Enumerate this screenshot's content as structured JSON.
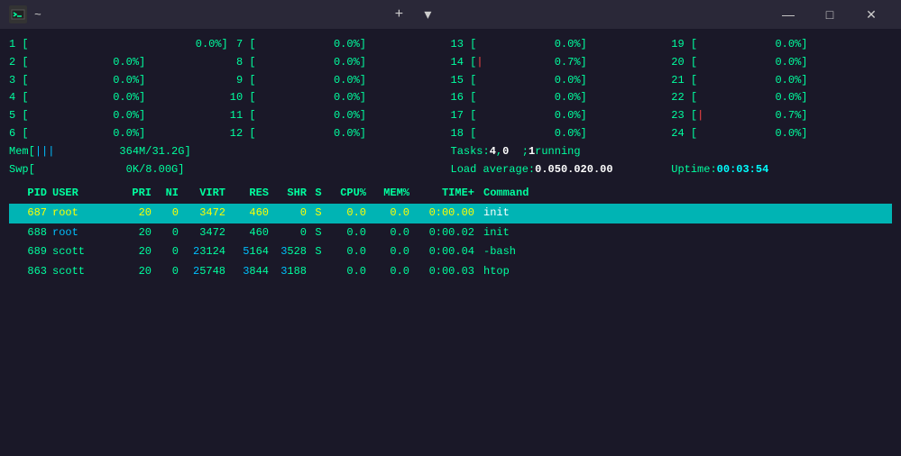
{
  "window": {
    "title": "~",
    "icon": "terminal-icon"
  },
  "titlebar": {
    "title": "~",
    "min_label": "—",
    "max_label": "□",
    "close_label": "✕",
    "new_tab_label": "+",
    "dropdown_label": "▾"
  },
  "cpu_rows": [
    {
      "num": "1",
      "bar": "",
      "pct": "0.0%"
    },
    {
      "num": "7",
      "bar": "",
      "pct": "0.0%"
    },
    {
      "num": "13",
      "bar": "",
      "pct": "0.0%"
    },
    {
      "num": "19",
      "bar": "",
      "pct": "0.0%"
    },
    {
      "num": "2",
      "bar": "",
      "pct": "0.0%"
    },
    {
      "num": "8",
      "bar": "",
      "pct": "0.0%"
    },
    {
      "num": "14",
      "bar": "|",
      "pct": "0.7%"
    },
    {
      "num": "20",
      "bar": "",
      "pct": "0.0%"
    },
    {
      "num": "3",
      "bar": "",
      "pct": "0.0%"
    },
    {
      "num": "9",
      "bar": "",
      "pct": "0.0%"
    },
    {
      "num": "15",
      "bar": "",
      "pct": "0.0%"
    },
    {
      "num": "21",
      "bar": "",
      "pct": "0.0%"
    },
    {
      "num": "4",
      "bar": "",
      "pct": "0.0%"
    },
    {
      "num": "10",
      "bar": "",
      "pct": "0.0%"
    },
    {
      "num": "16",
      "bar": "",
      "pct": "0.0%"
    },
    {
      "num": "22",
      "bar": "",
      "pct": "0.0%"
    },
    {
      "num": "5",
      "bar": "",
      "pct": "0.0%"
    },
    {
      "num": "11",
      "bar": "",
      "pct": "0.0%"
    },
    {
      "num": "17",
      "bar": "",
      "pct": "0.0%"
    },
    {
      "num": "23",
      "bar": "|",
      "pct": "0.7%"
    },
    {
      "num": "6",
      "bar": "",
      "pct": "0.0%"
    },
    {
      "num": "12",
      "bar": "",
      "pct": "0.0%"
    },
    {
      "num": "18",
      "bar": "",
      "pct": "0.0%"
    },
    {
      "num": "24",
      "bar": "",
      "pct": "0.0%"
    }
  ],
  "mem": {
    "label": "Mem",
    "bars": "|||",
    "value": "364M/31.2G]"
  },
  "swp": {
    "label": "Swp",
    "bars": "",
    "value": "0K/8.00G]"
  },
  "tasks": {
    "label": "Tasks:",
    "total": "4",
    "sleeping": "0",
    "running_label": "running",
    "running_count": "1"
  },
  "load": {
    "label": "Load average:",
    "v1": "0.05",
    "v2": "0.02",
    "v3": "0.00"
  },
  "uptime": {
    "label": "Uptime:",
    "value": "00:03:54"
  },
  "table": {
    "headers": {
      "pid": "PID",
      "user": "USER",
      "pri": "PRI",
      "ni": "NI",
      "virt": "VIRT",
      "res": "RES",
      "shr": "SHR",
      "s": "S",
      "cpu": "CPU%",
      "mem": "MEM%",
      "time": "TIME+",
      "cmd": "Command"
    },
    "rows": [
      {
        "pid": "687",
        "user": "root",
        "pri": "20",
        "ni": "0",
        "virt": "3472",
        "res": "460",
        "shr": "0",
        "s": "S",
        "cpu": "0.0",
        "mem": "0.0",
        "time": "0:00.00",
        "cmd": "init",
        "selected": true
      },
      {
        "pid": "688",
        "user": "root",
        "pri": "20",
        "ni": "0",
        "virt": "3472",
        "res": "460",
        "shr": "0",
        "s": "S",
        "cpu": "0.0",
        "mem": "0.0",
        "time": "0:00.02",
        "cmd": "init",
        "selected": false
      },
      {
        "pid": "689",
        "user": "scott",
        "pri": "20",
        "ni": "0",
        "virt": "23124",
        "res": "5164",
        "shr": "3528",
        "s": "S",
        "cpu": "0.0",
        "mem": "0.0",
        "time": "0:00.04",
        "cmd": "-bash",
        "selected": false
      },
      {
        "pid": "863",
        "user": "scott",
        "pri": "20",
        "ni": "0",
        "virt": "25748",
        "res": "3844",
        "shr": "3188",
        "s": " ",
        "cpu": "0.0",
        "mem": "0.0",
        "time": "0:00.03",
        "cmd": "htop",
        "selected": false
      }
    ]
  },
  "colors": {
    "bg": "#1a1828",
    "titlebar": "#2a2838",
    "accent_cyan": "#00b4b4",
    "text_green": "#00ff9f",
    "text_yellow": "#ffff00",
    "text_blue": "#00bfff",
    "text_red": "#ff4444",
    "text_white": "#ffffff"
  }
}
